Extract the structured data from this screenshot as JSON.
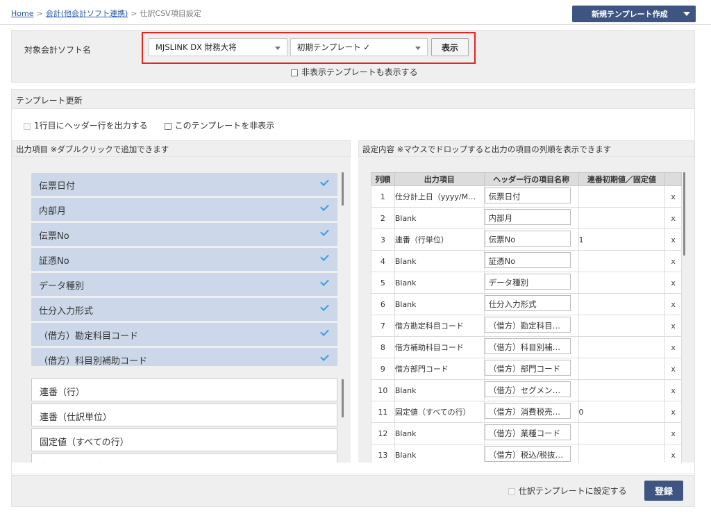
{
  "breadcrumb": {
    "home": "Home",
    "sep": ">",
    "accounting": "会計(他会計ソフト連携)",
    "current": "仕訳CSV項目設定"
  },
  "header": {
    "new_template_label": "新規テンプレート作成"
  },
  "selector": {
    "label": "対象会計ソフト名",
    "software": "MJSLINK DX 財務大将",
    "template": "初期テンプレート ✓",
    "show_button": "表示",
    "show_hidden_label": "非表示テンプレートも表示する"
  },
  "template_update": {
    "title": "テンプレート更新",
    "header_row_label": "1行目にヘッダー行を出力する",
    "hide_template_label": "このテンプレートを非表示"
  },
  "output_items": {
    "title": "出力項目 ※ダブルクリックで追加できます",
    "selected": [
      "伝票日付",
      "内部月",
      "伝票No",
      "証憑No",
      "データ種別",
      "仕分入力形式",
      "（借方）勘定科目コード",
      "（借方）科目別補助コード"
    ],
    "available": [
      "連番（行）",
      "連番（仕訳単位）",
      "固定値（すべての行）",
      "連番（仕訳単位）"
    ]
  },
  "settings": {
    "title": "設定内容 ※マウスでドロップすると出力の項目の列順を表示できます",
    "columns": {
      "no": "列順",
      "item": "出力項目",
      "header": "ヘッダー行の項目名称",
      "init": "連番初期値／固定値"
    },
    "rows": [
      {
        "no": "1",
        "item": "仕分計上日（yyyy/M…",
        "header": "伝票日付",
        "init": "",
        "del": "x"
      },
      {
        "no": "2",
        "item": "Blank",
        "header": "内部月",
        "init": "",
        "del": "x"
      },
      {
        "no": "3",
        "item": "連番（行単位）",
        "header": "伝票No",
        "init": "1",
        "del": "x"
      },
      {
        "no": "4",
        "item": "Blank",
        "header": "証憑No",
        "init": "",
        "del": "x"
      },
      {
        "no": "5",
        "item": "Blank",
        "header": "データ種別",
        "init": "",
        "del": "x"
      },
      {
        "no": "6",
        "item": "Blank",
        "header": "仕分入力形式",
        "init": "",
        "del": "x"
      },
      {
        "no": "7",
        "item": "借方勘定科目コード",
        "header": "（借方）勘定科目…",
        "init": "",
        "del": "x"
      },
      {
        "no": "8",
        "item": "借方補助科目コード",
        "header": "（借方）科目別補…",
        "init": "",
        "del": "x"
      },
      {
        "no": "9",
        "item": "借方部門コード",
        "header": "（借方）部門コード",
        "init": "",
        "del": "x"
      },
      {
        "no": "10",
        "item": "Blank",
        "header": "（借方）セグメン…",
        "init": "",
        "del": "x"
      },
      {
        "no": "11",
        "item": "固定値（すべての行）",
        "header": "（借方）消費税売…",
        "init": "0",
        "del": "x"
      },
      {
        "no": "12",
        "item": "Blank",
        "header": "（借方）業種コード",
        "init": "",
        "del": "x"
      },
      {
        "no": "13",
        "item": "Blank",
        "header": "（借方）税込/税抜…",
        "init": "",
        "del": "x"
      }
    ]
  },
  "footer": {
    "journal_template_label": "仕訳テンプレートに設定する",
    "register_label": "登録"
  },
  "colors": {
    "accent": "#3d5580",
    "highlight": "#e52424",
    "selected_item": "#ccd8ea",
    "check": "#3b9ae1"
  }
}
